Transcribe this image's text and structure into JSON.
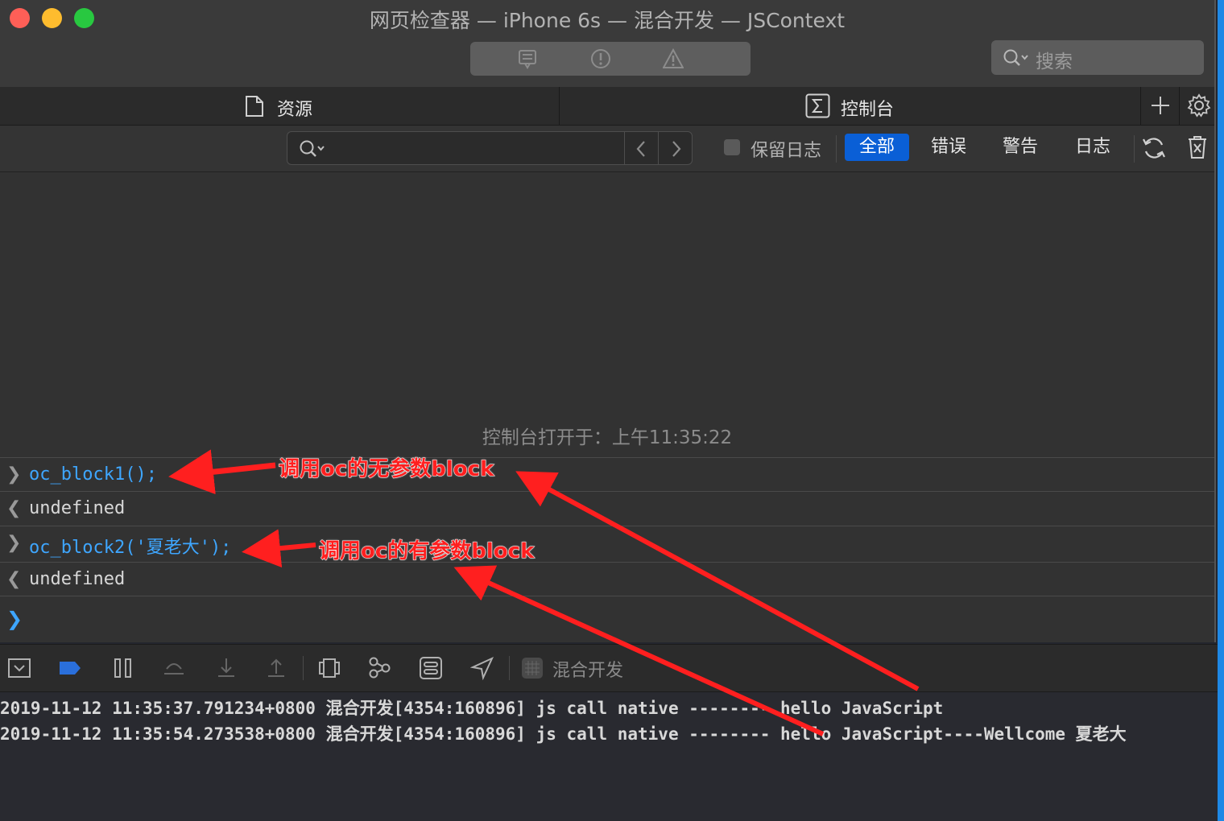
{
  "window": {
    "title": "网页检查器 — iPhone 6s — 混合开发 — JSContext"
  },
  "toolbar": {
    "segments": [
      "messages-icon",
      "exclamation-circle-icon",
      "warning-triangle-icon"
    ],
    "search_placeholder": "搜索"
  },
  "tabs": {
    "resources_label": "资源",
    "console_label": "控制台"
  },
  "filter": {
    "preserve_log_label": "保留日志",
    "levels": [
      "全部",
      "错误",
      "警告",
      "日志"
    ],
    "active_level": "全部"
  },
  "console": {
    "opened_at": "控制台打开于：上午11:35:22",
    "entries": [
      {
        "kind": "input",
        "text": "oc_block1();"
      },
      {
        "kind": "output",
        "text": "undefined"
      },
      {
        "kind": "input",
        "text": "oc_block2('夏老大');"
      },
      {
        "kind": "output",
        "text": "undefined"
      }
    ]
  },
  "debugbar": {
    "target_label": "混合开发"
  },
  "log": {
    "lines": [
      "2019-11-12 11:35:37.791234+0800 混合开发[4354:160896] js call native -------- hello JavaScript",
      "2019-11-12 11:35:54.273538+0800 混合开发[4354:160896] js call native -------- hello JavaScript----Wellcome 夏老大"
    ]
  },
  "annotations": {
    "first": "调用oc的无参数block",
    "second": "调用oc的有参数block",
    "color": "#ff1f1f"
  }
}
